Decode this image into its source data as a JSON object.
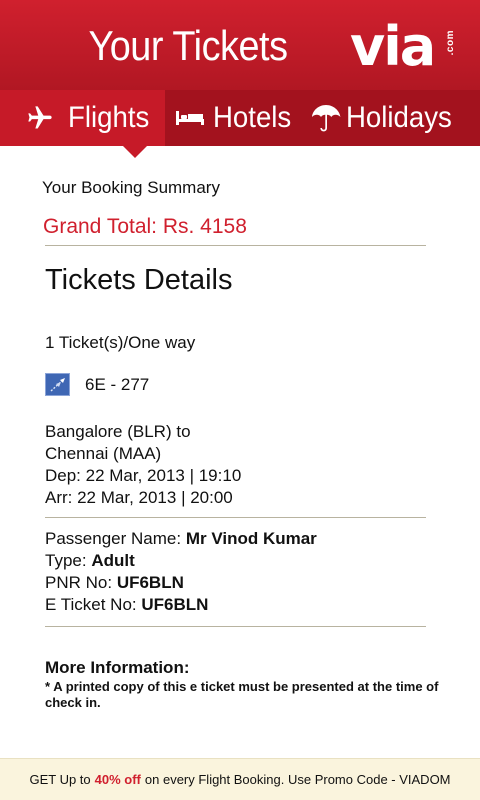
{
  "header": {
    "title": "Your Tickets",
    "logo_main": "via",
    "logo_suffix": ".com"
  },
  "tabs": [
    {
      "label": "Flights",
      "icon": "airplane-icon",
      "active": true
    },
    {
      "label": "Hotels",
      "icon": "bed-icon",
      "active": false
    },
    {
      "label": "Holidays",
      "icon": "umbrella-icon",
      "active": false
    }
  ],
  "summary": {
    "label": "Your Booking Summary",
    "grand_total": "Grand Total: Rs. 4158"
  },
  "details": {
    "title": "Tickets Details",
    "ticket_type": "1 Ticket(s)/One way",
    "airline_icon": "airline-logo-icon",
    "flight_no": "6E - 277",
    "route_line1": "Bangalore (BLR) to",
    "route_line2": "Chennai (MAA)",
    "departure": "Dep: 22 Mar, 2013 | 19:10",
    "arrival": "Arr: 22 Mar, 2013 | 20:00"
  },
  "passenger": {
    "name_label": "Passenger Name:",
    "name_value": "Mr Vinod Kumar",
    "type_label": "Type:",
    "type_value": "Adult",
    "pnr_label": "PNR No:",
    "pnr_value": "UF6BLN",
    "eticket_label": "E Ticket No:",
    "eticket_value": "UF6BLN"
  },
  "more_info": {
    "title": "More Information:",
    "note": "* A printed copy of this e ticket must be presented at the time of check in."
  },
  "footer": {
    "prefix": "GET Up to",
    "highlight": "40% off",
    "suffix": "on every Flight Booking. Use Promo Code - VIADOM"
  },
  "colors": {
    "brand_red": "#d0202e",
    "tab_bar": "#a3121e",
    "footer_bg": "#faf4dd"
  }
}
